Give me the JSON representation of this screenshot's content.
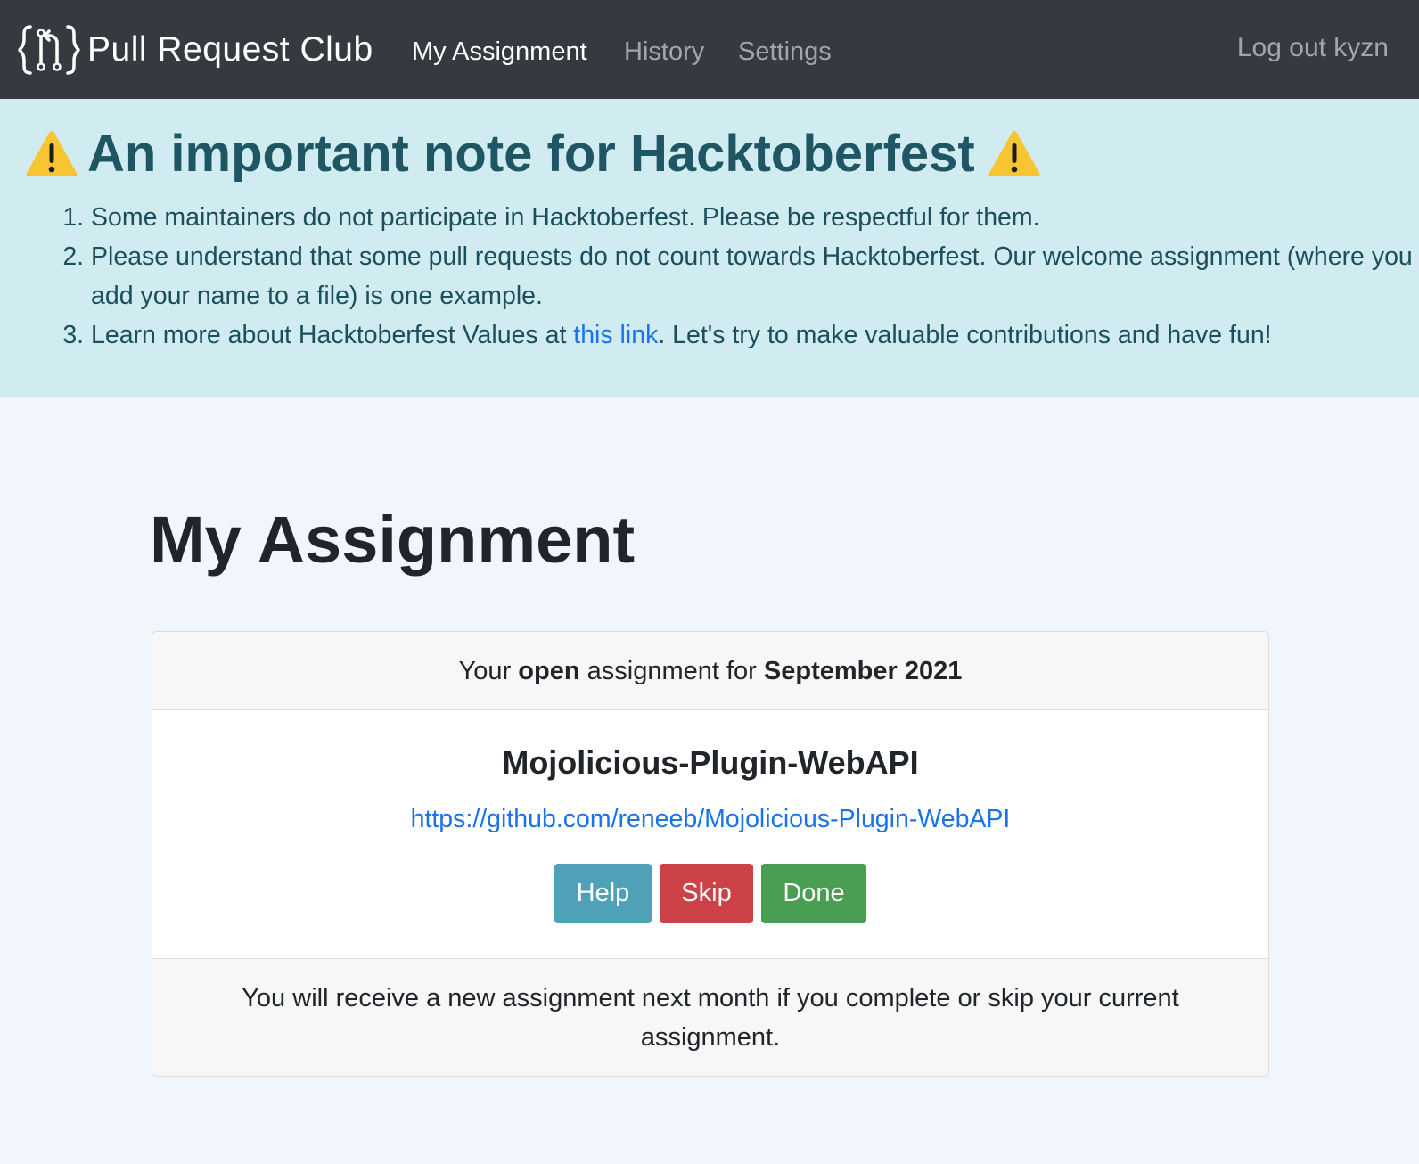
{
  "navbar": {
    "brand": "Pull Request Club",
    "brand_icon": "pull-request-braces-icon",
    "links": [
      {
        "label": "My Assignment",
        "active": true
      },
      {
        "label": "History",
        "active": false
      },
      {
        "label": "Settings",
        "active": false
      }
    ],
    "logout": "Log out kyzn"
  },
  "alert": {
    "heading": "An important note for Hacktoberfest",
    "icon": "warning-icon",
    "items": [
      {
        "text": "Some maintainers do not participate in Hacktoberfest. Please be respectful for them."
      },
      {
        "text": "Please understand that some pull requests do not count towards Hacktoberfest. Our welcome assignment (where you add your name to a file) is one example."
      },
      {
        "before": "Learn more about Hacktoberfest Values at ",
        "link": "this link",
        "after": ". Let's try to make valuable contributions and have fun!"
      }
    ],
    "colors": {
      "background": "#d1ecf1",
      "text": "#0c5460"
    }
  },
  "main": {
    "title": "My Assignment",
    "card": {
      "header": {
        "prefix": "Your ",
        "status": "open",
        "middle": " assignment for ",
        "period": "September 2021"
      },
      "repo_name": "Mojolicious-Plugin-WebAPI",
      "repo_url": "https://github.com/reneeb/Mojolicious-Plugin-WebAPI",
      "buttons": {
        "help": "Help",
        "skip": "Skip",
        "done": "Done"
      },
      "footer": "You will receive a new assignment next month if you complete or skip your current assignment."
    }
  },
  "colors": {
    "navbar": "#343a40",
    "page_background": "#f1f6fd",
    "link": "#1a73e8",
    "help": "#4fa1b8",
    "skip": "#cc4247",
    "done": "#4a9e52"
  }
}
